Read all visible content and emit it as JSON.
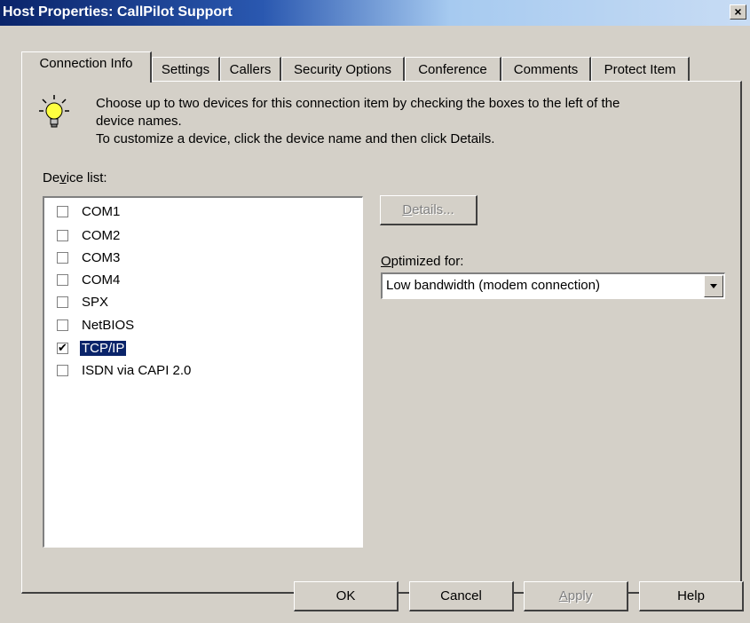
{
  "window": {
    "title": "Host Properties: CallPilot Support",
    "close_label": "×"
  },
  "tabs": [
    {
      "label": "Connection Info"
    },
    {
      "label": "Settings"
    },
    {
      "label": "Callers"
    },
    {
      "label": "Security Options"
    },
    {
      "label": "Conference"
    },
    {
      "label": "Comments"
    },
    {
      "label": "Protect Item"
    }
  ],
  "tip": {
    "icon": "lightbulb-icon",
    "line1": "Choose up to two devices for this connection item by checking the boxes to the left of the",
    "line2": "device names.",
    "line3": "To customize a device, click the device name and then click Details."
  },
  "device_list": {
    "label_pre": "De",
    "label_u": "v",
    "label_post": "ice list:",
    "items": [
      {
        "label": "COM1",
        "checked": false
      },
      {
        "label": "COM2",
        "checked": false
      },
      {
        "label": "COM3",
        "checked": false
      },
      {
        "label": "COM4",
        "checked": false
      },
      {
        "label": "SPX",
        "checked": false
      },
      {
        "label": "NetBIOS",
        "checked": false
      },
      {
        "label": "TCP/IP",
        "checked": true,
        "selected": true
      },
      {
        "label": "ISDN via CAPI 2.0",
        "checked": false
      }
    ]
  },
  "details": {
    "label_u": "D",
    "label_rest": "etails...",
    "enabled": false
  },
  "optimized": {
    "label_u": "O",
    "label_rest": "ptimized for:",
    "value": "Low bandwidth (modem connection)"
  },
  "footer": {
    "ok": "OK",
    "cancel": "Cancel",
    "apply_u": "A",
    "apply_rest": "pply",
    "help": "Help"
  },
  "colors": {
    "title_bar": "#0a246a",
    "face": "#d4d0c8",
    "selection": "#0a246a"
  }
}
